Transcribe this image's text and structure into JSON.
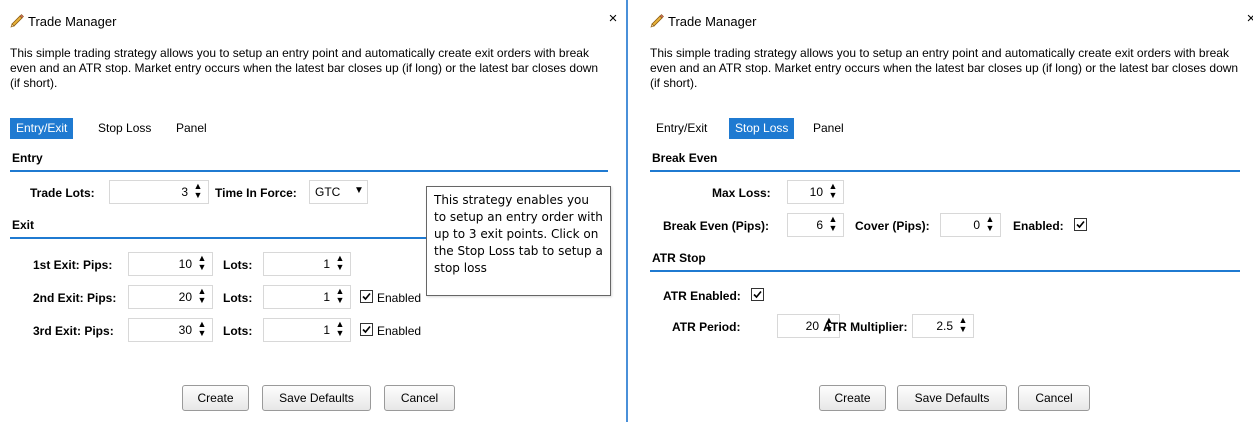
{
  "left": {
    "title": "Trade Manager",
    "close_glyph": "×",
    "description": "This simple trading strategy allows you to setup an entry point and automatically create exit orders with break even and an ATR stop. Market entry occurs when the latest bar closes up (if long) or the latest bar closes down (if short).",
    "tabs": [
      "Entry/Exit",
      "Stop Loss",
      "Panel"
    ],
    "active_tab": "Entry/Exit",
    "entry": {
      "section": "Entry",
      "trade_lots_label": "Trade Lots:",
      "trade_lots_value": "3",
      "time_in_force_label": "Time In Force:",
      "time_in_force_value": "GTC"
    },
    "exit": {
      "section": "Exit",
      "rows": [
        {
          "label": "1st Exit: Pips:",
          "pips": "10",
          "lots_label": "Lots:",
          "lots": "1",
          "has_enabled": false,
          "enabled_label": ""
        },
        {
          "label": "2nd Exit: Pips:",
          "pips": "20",
          "lots_label": "Lots:",
          "lots": "1",
          "has_enabled": true,
          "enabled_label": "Enabled"
        },
        {
          "label": "3rd Exit: Pips:",
          "pips": "30",
          "lots_label": "Lots:",
          "lots": "1",
          "has_enabled": true,
          "enabled_label": "Enabled"
        }
      ]
    },
    "tooltip": "This strategy enables you to setup an entry order with up to 3 exit points. Click on the Stop Loss tab to setup a stop loss",
    "buttons": {
      "create": "Create",
      "save_defaults": "Save Defaults",
      "cancel": "Cancel"
    }
  },
  "right": {
    "title": "Trade Manager",
    "close_glyph": "×",
    "description": "This simple trading strategy allows you to setup an entry point and automatically create exit orders with break even and an ATR stop. Market entry occurs when the latest bar closes up (if long) or the latest bar closes down (if short).",
    "tabs": [
      "Entry/Exit",
      "Stop Loss",
      "Panel"
    ],
    "active_tab": "Stop Loss",
    "break_even": {
      "section": "Break Even",
      "max_loss_label": "Max Loss:",
      "max_loss_value": "10",
      "break_even_label": "Break Even (Pips):",
      "break_even_value": "6",
      "cover_label": "Cover (Pips):",
      "cover_value": "0",
      "enabled_label": "Enabled:",
      "enabled": true
    },
    "atr_stop": {
      "section": "ATR Stop",
      "atr_enabled_label": "ATR Enabled:",
      "atr_enabled": true,
      "period_label": "ATR Period:",
      "period_value": "20",
      "multiplier_label": "ATR Multiplier:",
      "multiplier_value": "2.5"
    },
    "buttons": {
      "create": "Create",
      "save_defaults": "Save Defaults",
      "cancel": "Cancel"
    }
  },
  "icons": {
    "title": "pencil-icon",
    "close": "close-icon",
    "spinner": "spinner-arrows-icon",
    "dropdown": "dropdown-arrow-icon",
    "check": "checkmark-icon"
  },
  "colors": {
    "accent": "#1f7ad1",
    "border": "#4a90d9",
    "pencil_body": "#e8b23a"
  }
}
